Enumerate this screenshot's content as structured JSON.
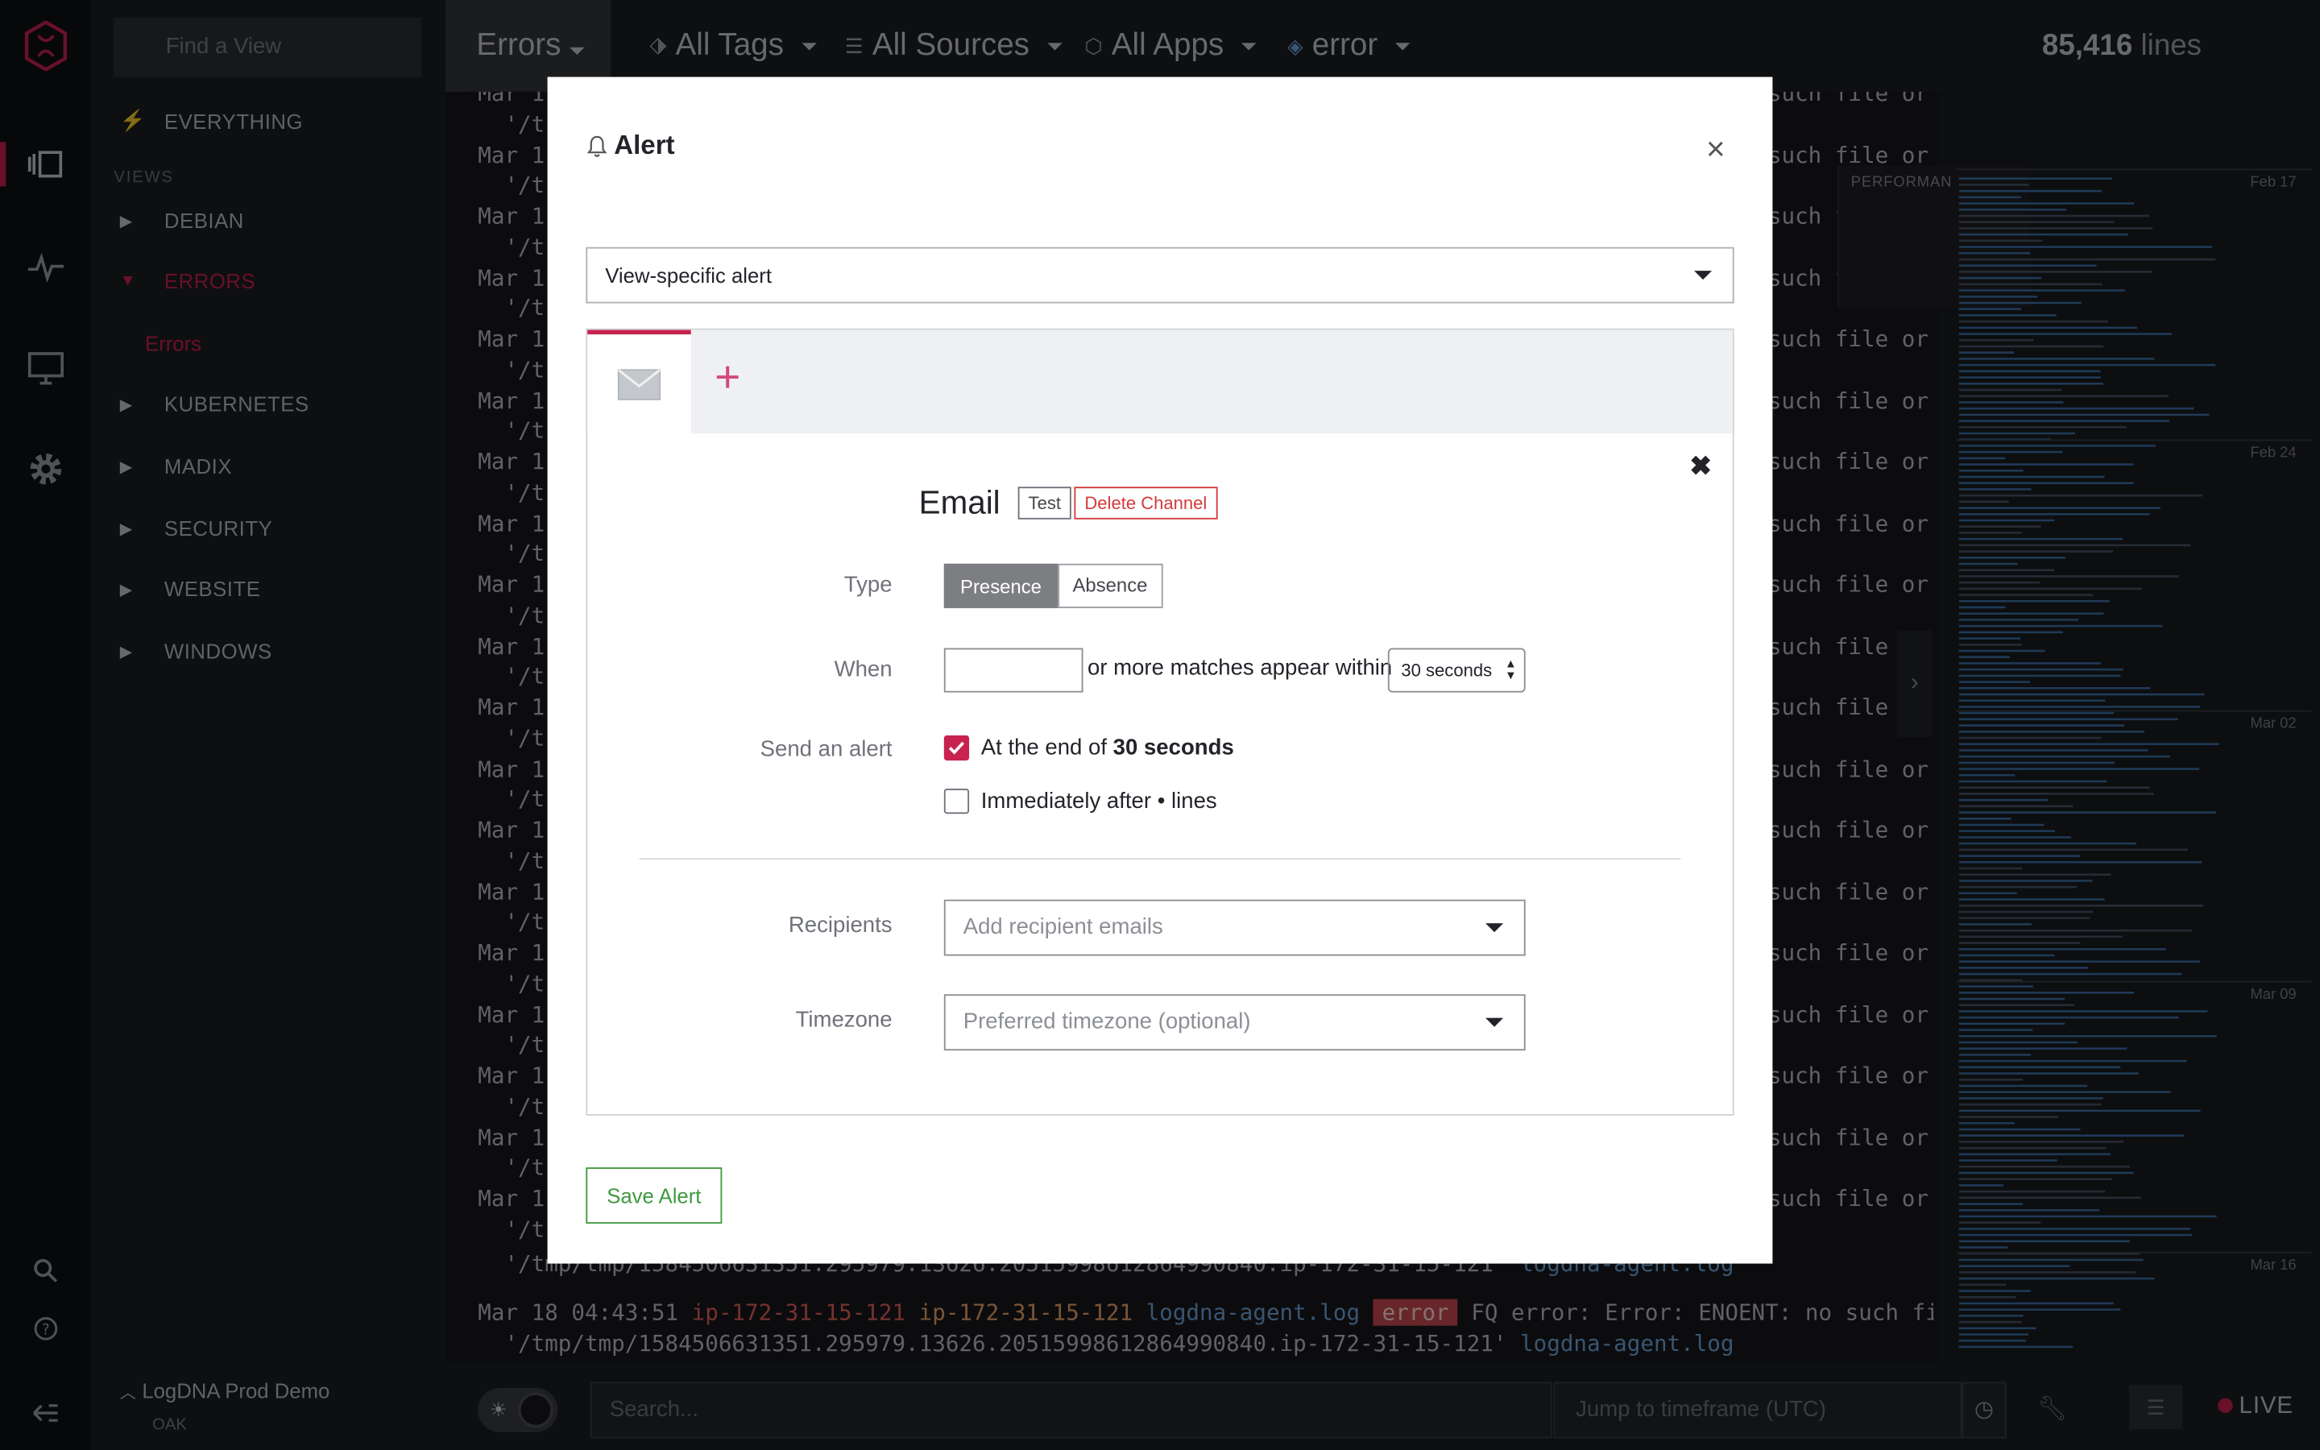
{
  "sidebar": {
    "find_placeholder": "Find a View",
    "everything": "EVERYTHING",
    "views_label": "VIEWS",
    "items": [
      {
        "label": "DEBIAN",
        "expanded": false
      },
      {
        "label": "ERRORS",
        "expanded": true
      },
      {
        "label": "KUBERNETES",
        "expanded": false
      },
      {
        "label": "MADIX",
        "expanded": false
      },
      {
        "label": "SECURITY",
        "expanded": false
      },
      {
        "label": "WEBSITE",
        "expanded": false
      },
      {
        "label": "WINDOWS",
        "expanded": false
      }
    ],
    "sub_item": "Errors",
    "org_name": "LogDNA Prod Demo",
    "org_sub": "OAK"
  },
  "topbar": {
    "active_view": "Errors",
    "tags": "All Tags",
    "sources": "All Sources",
    "apps": "All Apps",
    "level": "error",
    "line_count": "85,416",
    "lines_word": "lines"
  },
  "logs": {
    "prefix": "Mar 1",
    "path_prefix": "'/t",
    "tail": "such file or ",
    "full_line": {
      "timestamp": "Mar 18 04:43:51",
      "host": "ip-172-31-15-121",
      "source": "ip-172-31-15-121",
      "app": "logdna-agent.log",
      "level": "error",
      "message": "FQ error: Error: ENOENT: no such file or "
    },
    "path_line": "'/tmp/tmp/1584506631351.295979.13626.20515998612864990840.ip-172-31-15-121'",
    "path_app": "logdna-agent.log"
  },
  "timeline": {
    "labels": [
      "Feb 17",
      "Feb 24",
      "Mar 02",
      "Mar 09",
      "Mar 16"
    ],
    "perf_label": "PERFORMAN"
  },
  "bottombar": {
    "search_placeholder": "Search...",
    "jump_placeholder": "Jump to timeframe (UTC)",
    "live": "LIVE"
  },
  "modal": {
    "title": "Alert",
    "alert_type": "View-specific alert",
    "channel": {
      "title": "Email",
      "test_label": "Test",
      "delete_label": "Delete Channel",
      "type_label": "Type",
      "type_options": [
        "Presence",
        "Absence"
      ],
      "type_selected": "Presence",
      "when_label": "When",
      "when_value": "",
      "when_text": "or more matches appear within",
      "within_value": "30 seconds",
      "send_label": "Send an alert",
      "option_end_prefix": "At the end of",
      "option_end_value": "30 seconds",
      "option_end_checked": true,
      "option_immediate": "Immediately after • lines",
      "option_immediate_checked": false,
      "recipients_label": "Recipients",
      "recipients_placeholder": "Add recipient emails",
      "timezone_label": "Timezone",
      "timezone_placeholder": "Preferred timezone (optional)"
    },
    "save_label": "Save Alert"
  },
  "colors": {
    "accent": "#c8224f",
    "save": "#3f9a3f",
    "delete": "#d33b3b"
  }
}
